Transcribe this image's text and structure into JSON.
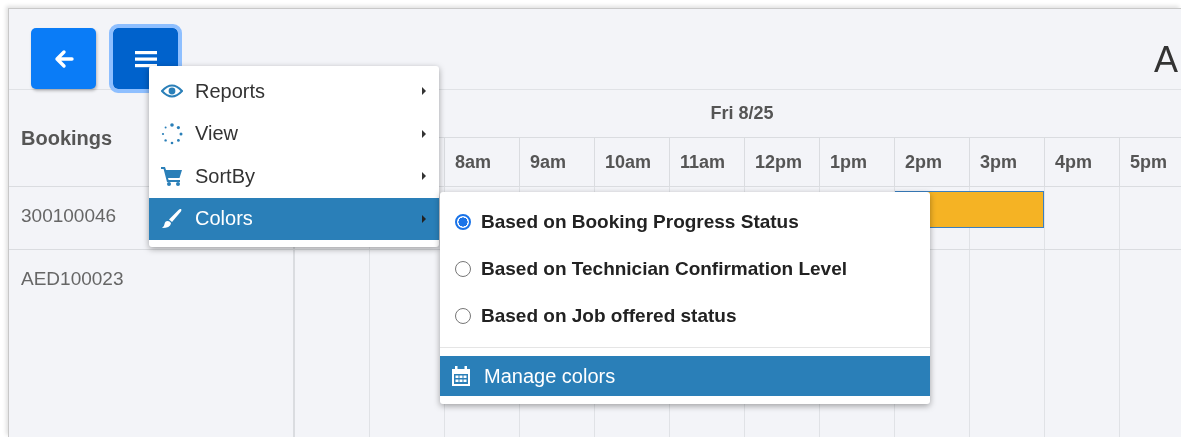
{
  "toolbar": {
    "title": "A"
  },
  "menu": {
    "items": [
      {
        "label": "Reports",
        "selected": false
      },
      {
        "label": "View",
        "selected": false
      },
      {
        "label": "SortBy",
        "selected": false
      },
      {
        "label": "Colors",
        "selected": true
      }
    ]
  },
  "submenu": {
    "options": [
      {
        "label": "Based on Booking Progress Status",
        "selected": true
      },
      {
        "label": "Based on Technician Confirmation Level",
        "selected": false
      },
      {
        "label": "Based on Job offered status",
        "selected": false
      }
    ],
    "action": {
      "label": "Manage colors",
      "highlighted": true
    }
  },
  "schedule": {
    "resource_header": "Bookings",
    "date": "Fri 8/25",
    "hours": [
      "8am",
      "9am",
      "10am",
      "11am",
      "12pm",
      "1pm",
      "2pm",
      "3pm",
      "4pm",
      "5pm"
    ],
    "bookings": [
      {
        "id": "300100046",
        "events": [
          {
            "color": "#f5b324"
          }
        ]
      },
      {
        "id": "AED100023"
      }
    ]
  }
}
